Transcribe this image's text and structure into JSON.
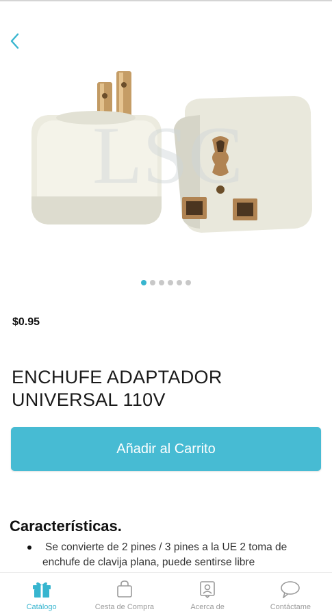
{
  "nav": {
    "back_icon": "chevron-left-icon",
    "accent_color": "#37b5cf"
  },
  "product": {
    "image_watermark": "LSC",
    "carousel": {
      "total": 6,
      "active_index": 0
    },
    "price": "$0.95",
    "title": "ENCHUFE ADAPTADOR UNIVERSAL 110V"
  },
  "actions": {
    "add_to_cart_label": "Añadir al Carrito",
    "button_color": "#47bbd3"
  },
  "features": {
    "heading": "Características.",
    "items": [
      "Se convierte de 2 pines / 3 pines a la UE  2 toma de enchufe de clavija plana, puede sentirse libre"
    ]
  },
  "tabbar": {
    "items": [
      {
        "label": "Catálogo",
        "icon": "gift-icon",
        "active": true
      },
      {
        "label": "Cesta de Compra",
        "icon": "shopping-bag-icon",
        "active": false
      },
      {
        "label": "Acerca de",
        "icon": "id-card-icon",
        "active": false
      },
      {
        "label": "Contáctame",
        "icon": "chat-bubble-icon",
        "active": false
      }
    ]
  }
}
